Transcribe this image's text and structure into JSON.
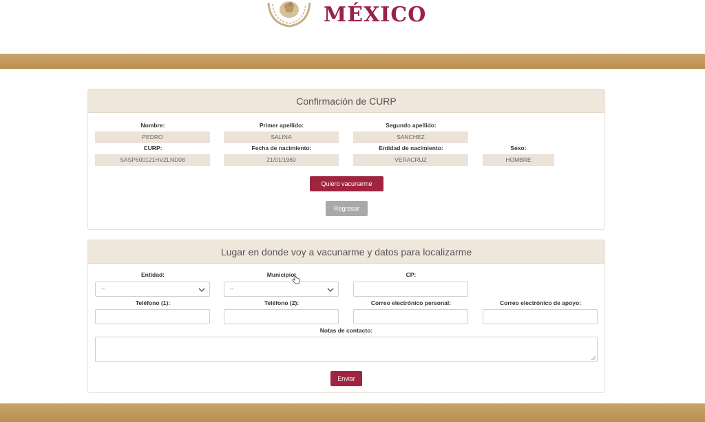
{
  "header": {
    "brand": "MÉXICO",
    "seal_icon": "coat-of-arms-icon"
  },
  "colors": {
    "brand": "#9a2148",
    "band": "#c09a5c",
    "panel_header": "#efe6dc",
    "value_bg": "#ede2d8",
    "primary_button": "#a0243f",
    "secondary_button": "#a9a9a9"
  },
  "confirm": {
    "title": "Confirmación de CURP",
    "labels": {
      "nombre": "Nombre:",
      "primer_apellido": "Primer apellido:",
      "segundo_apellido": "Segundo apellido:",
      "curp": "CURP:",
      "fecha": "Fecha de nacimiento:",
      "entidad": "Entidad de nacimiento:",
      "sexo": "Sexo:"
    },
    "values": {
      "nombre": "PEDRO",
      "primer_apellido": "SALINA",
      "segundo_apellido": "SANCHEZ",
      "curp": "SASP600121HVZLND08",
      "fecha": "21/01/1960",
      "entidad": "VERACRUZ",
      "sexo": "HOMBRE"
    },
    "vaccinate_button": "Quiero vacunarme",
    "back_button": "Regresar"
  },
  "location": {
    "title": "Lugar en donde voy a vacunarme y datos para localizarme",
    "labels": {
      "entidad": "Entidad:",
      "municipio": "Municipio:",
      "cp": "CP:",
      "telefono1": "Teléfono (1):",
      "telefono2": "Teléfono (2):",
      "correo_personal": "Correo electrónico personal:",
      "correo_apoyo": "Correo electrónico de apoyo:",
      "notas": "Notas de contacto:"
    },
    "selects": {
      "entidad": "--",
      "municipio": "--"
    },
    "send_button": "Enviar"
  }
}
